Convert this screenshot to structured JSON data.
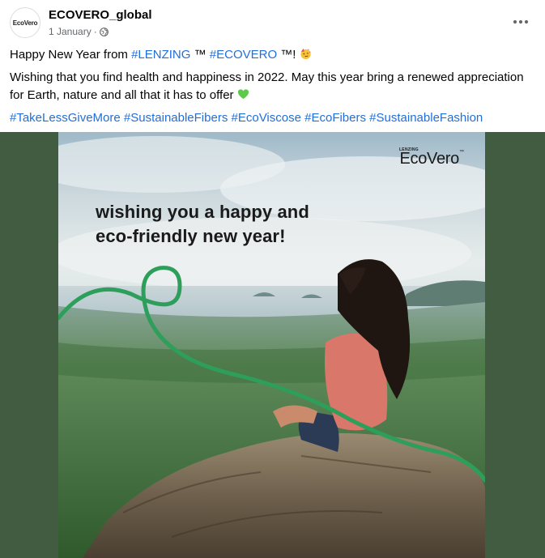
{
  "post": {
    "avatar_text": "EcoVero",
    "page_name": "ECOVERO_global",
    "date": "1 January",
    "separator": "·",
    "more_icon": "more-horizontal-icon",
    "privacy_icon": "globe-icon"
  },
  "text": {
    "line1_prefix": "Happy New Year from ",
    "line1_tag1": "#LENZING",
    "line1_mid": " ™ ",
    "line1_tag2": "#ECOVERO",
    "line1_suffix": " ™! ",
    "line1_emoji": "partying-face-emoji",
    "line2": "Wishing that you find health and happiness in 2022. May this year bring a renewed appreciation for Earth, nature and all that it has to offer ",
    "line2_emoji": "green-heart-emoji",
    "hashtags": [
      "#TakeLessGiveMore",
      "#SustainableFibers",
      "#EcoViscose",
      "#EcoFibers",
      "#SustainableFashion"
    ]
  },
  "image": {
    "headline_line1": "wishing you a happy and",
    "headline_line2": "eco-friendly new year!",
    "brand_small": "LENZING",
    "brand_main": "EcoVero",
    "brand_tm": "™",
    "background_color": "#415c40",
    "accent_color": "#2e9e5b"
  }
}
